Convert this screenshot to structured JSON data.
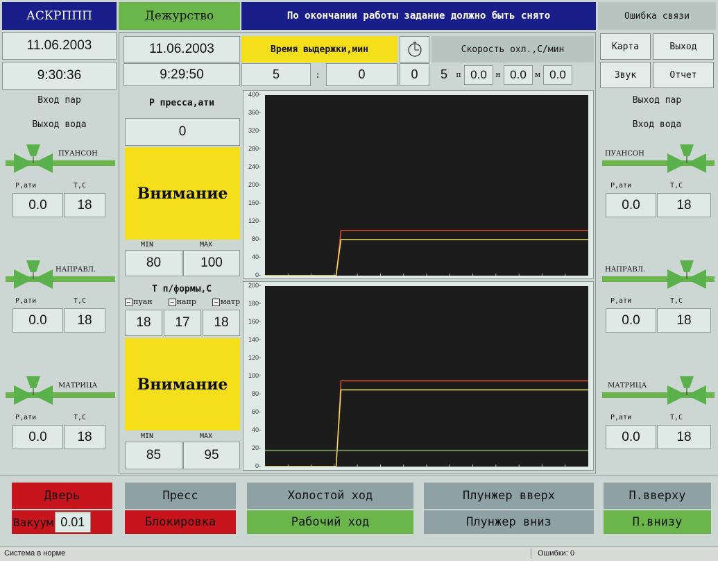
{
  "header": {
    "app_name": "АСКРППП",
    "mode": "Дежурство",
    "message": "По окончании работы задание должно быть снято",
    "error": "Ошибка связи"
  },
  "left": {
    "date": "11.06.2003",
    "time": "9:30:36",
    "inlet": "Вход пар",
    "outlet": "Выход вода",
    "valves": [
      {
        "name": "ПУАНСОН",
        "p_label": "Р,ати",
        "t_label": "Т,С",
        "p": "0.0",
        "t": "18"
      },
      {
        "name": "НАПРАВЛ.",
        "p_label": "Р,ати",
        "t_label": "Т,С",
        "p": "0.0",
        "t": "18"
      },
      {
        "name": "МАТРИЦА",
        "p_label": "Р,ати",
        "t_label": "Т,С",
        "p": "0.0",
        "t": "18"
      }
    ]
  },
  "right": {
    "inlet": "Выход пар",
    "outlet": "Вход вода",
    "valves": [
      {
        "name": "ПУАНСОН",
        "p_label": "Р,ати",
        "t_label": "Т,С",
        "p": "0.0",
        "t": "18"
      },
      {
        "name": "НАПРАВЛ.",
        "p_label": "Р,ати",
        "t_label": "Т,С",
        "p": "0.0",
        "t": "18"
      },
      {
        "name": "МАТРИЦА",
        "p_label": "Р,ати",
        "t_label": "Т,С",
        "p": "0.0",
        "t": "18"
      }
    ],
    "buttons": {
      "map": "Карта",
      "exit": "Выход",
      "sound": "Звук",
      "report": "Отчет"
    }
  },
  "center": {
    "date": "11.06.2003",
    "time": "9:29:50",
    "hold_label": "Время выдержки,мин",
    "cool_label": "Скорость охл.,С/мин",
    "hold_min": "5",
    "hold_sep": ":",
    "hold_sec": "0",
    "hold_extra": "0",
    "cool_rate": "5",
    "p_label": "п",
    "p_val": "0.0",
    "n_label": "н",
    "n_val": "0.0",
    "m_label": "м",
    "m_val": "0.0",
    "press_label": "Р пресса,ати",
    "press_val": "0",
    "attention1": "Внимание",
    "min1_label": "MIN",
    "max1_label": "MAX",
    "min1": "80",
    "max1": "100",
    "mold_label": "Т п/формы,С",
    "mold_cols": [
      "пуан",
      "напр",
      "матр"
    ],
    "mold_vals": [
      "18",
      "17",
      "18"
    ],
    "attention2": "Внимание",
    "min2_label": "MIN",
    "max2_label": "MAX",
    "min2": "85",
    "max2": "95"
  },
  "bottom": {
    "door": "Дверь",
    "vacuum_label": "Вакуум",
    "vacuum_val": "0.01",
    "press": "Пресс",
    "lock": "Блокировка",
    "idle": "Холостой ход",
    "work": "Рабочий ход",
    "plunger_up": "Плунжер вверх",
    "plunger_down": "Плунжер вниз",
    "p_up": "П.вверху",
    "p_down": "П.внизу"
  },
  "status": {
    "text": "Система в норме",
    "errors_label": "Ошибки:",
    "errors_val": "0"
  },
  "colors": {
    "accent_blue": "#1a1e8a",
    "green": "#6ab64a",
    "red": "#c8141c",
    "yellow": "#f5df1a",
    "red_line": "#e05035",
    "yellow_line": "#e8e060",
    "green_line": "#8aa068"
  },
  "chart_data": [
    {
      "type": "line",
      "ylim": [
        0,
        400
      ],
      "yticks": [
        0,
        40,
        80,
        120,
        160,
        200,
        240,
        280,
        320,
        360,
        400
      ],
      "series": [
        {
          "color": "#e05035",
          "points": [
            [
              0,
              0
            ],
            [
              0.22,
              0
            ],
            [
              0.235,
              100
            ],
            [
              1,
              100
            ]
          ]
        },
        {
          "color": "#e8e060",
          "points": [
            [
              0,
              0
            ],
            [
              0.22,
              0
            ],
            [
              0.235,
              80
            ],
            [
              1,
              80
            ]
          ]
        }
      ]
    },
    {
      "type": "line",
      "ylim": [
        0,
        200
      ],
      "yticks": [
        0,
        20,
        40,
        60,
        80,
        100,
        120,
        140,
        160,
        180,
        200
      ],
      "series": [
        {
          "color": "#e05035",
          "points": [
            [
              0,
              0
            ],
            [
              0.22,
              0
            ],
            [
              0.235,
              95
            ],
            [
              1,
              95
            ]
          ]
        },
        {
          "color": "#e8e060",
          "points": [
            [
              0,
              0
            ],
            [
              0.22,
              0
            ],
            [
              0.235,
              85
            ],
            [
              1,
              85
            ]
          ]
        },
        {
          "color": "#8aa068",
          "points": [
            [
              0,
              18
            ],
            [
              1,
              18
            ]
          ]
        }
      ]
    }
  ]
}
